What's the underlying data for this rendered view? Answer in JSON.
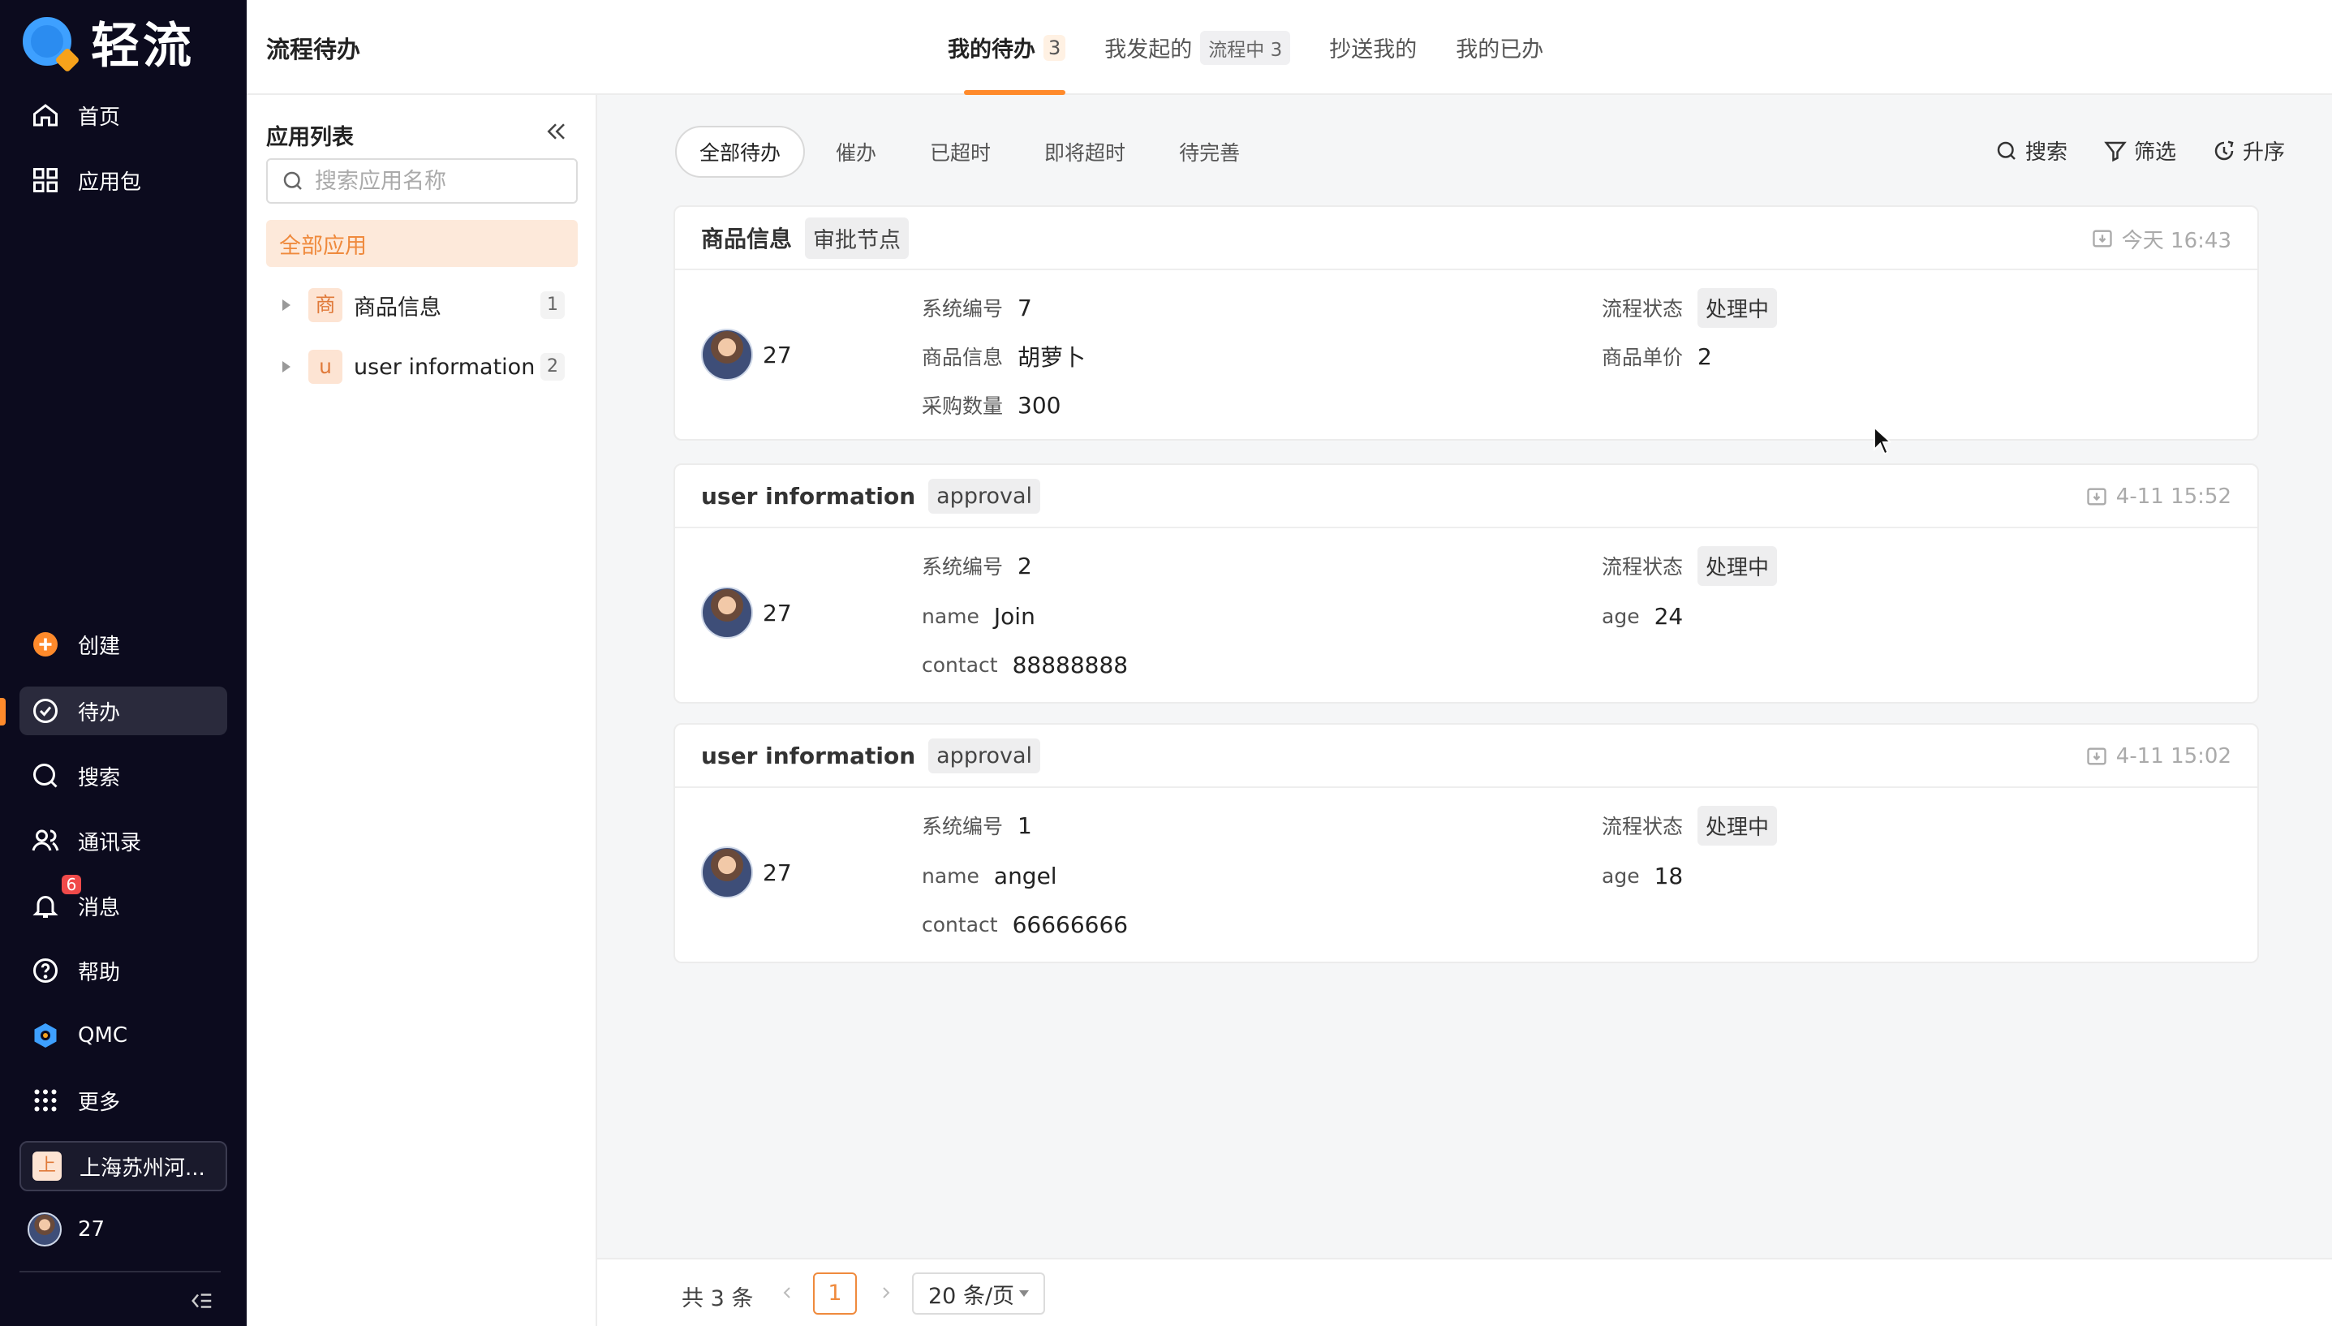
{
  "brand": {
    "name": "轻流"
  },
  "nav": {
    "home": "首页",
    "apps": "应用包",
    "create": "创建",
    "todo": "待办",
    "search": "搜索",
    "contacts": "通讯录",
    "messages": "消息",
    "messages_badge": "6",
    "help": "帮助",
    "qmc": "QMC",
    "more": "更多",
    "org_icon": "上",
    "org": "上海苏州河...",
    "user": "27"
  },
  "header": {
    "title": "流程待办",
    "tabs": [
      {
        "label": "我的待办",
        "count": "3"
      },
      {
        "label": "我发起的",
        "count": "流程中 3"
      },
      {
        "label": "抄送我的"
      },
      {
        "label": "我的已办"
      }
    ]
  },
  "applist": {
    "title": "应用列表",
    "search_placeholder": "搜索应用名称",
    "all": "全部应用",
    "items": [
      {
        "icon": "商",
        "name": "商品信息",
        "count": "1"
      },
      {
        "icon": "u",
        "name": "user information",
        "count": "2"
      }
    ]
  },
  "filters": {
    "items": [
      "全部待办",
      "催办",
      "已超时",
      "即将超时",
      "待完善"
    ],
    "search": "搜索",
    "filter": "筛选",
    "sort": "升序"
  },
  "cards": [
    {
      "app": "商品信息",
      "node": "审批节点",
      "time": "今天 16:43",
      "user": "27",
      "fields": [
        {
          "label": "系统编号",
          "value": "7"
        },
        {
          "label": "商品信息",
          "value": "胡萝卜"
        },
        {
          "label": "采购数量",
          "value": "300"
        }
      ],
      "right": [
        {
          "label": "流程状态",
          "value": "处理中"
        },
        {
          "label": "商品单价",
          "value": "2"
        }
      ]
    },
    {
      "app": "user information",
      "node": "approval",
      "time": "4-11 15:52",
      "user": "27",
      "fields": [
        {
          "label": "系统编号",
          "value": "2"
        },
        {
          "label": "name",
          "value": "Join"
        },
        {
          "label": "contact",
          "value": "88888888"
        }
      ],
      "right": [
        {
          "label": "流程状态",
          "value": "处理中"
        },
        {
          "label": "age",
          "value": "24"
        }
      ]
    },
    {
      "app": "user information",
      "node": "approval",
      "time": "4-11 15:02",
      "user": "27",
      "fields": [
        {
          "label": "系统编号",
          "value": "1"
        },
        {
          "label": "name",
          "value": "angel"
        },
        {
          "label": "contact",
          "value": "66666666"
        }
      ],
      "right": [
        {
          "label": "流程状态",
          "value": "处理中"
        },
        {
          "label": "age",
          "value": "18"
        }
      ]
    }
  ],
  "pager": {
    "total": "共 3 条",
    "current": "1",
    "size": "20 条/页"
  }
}
